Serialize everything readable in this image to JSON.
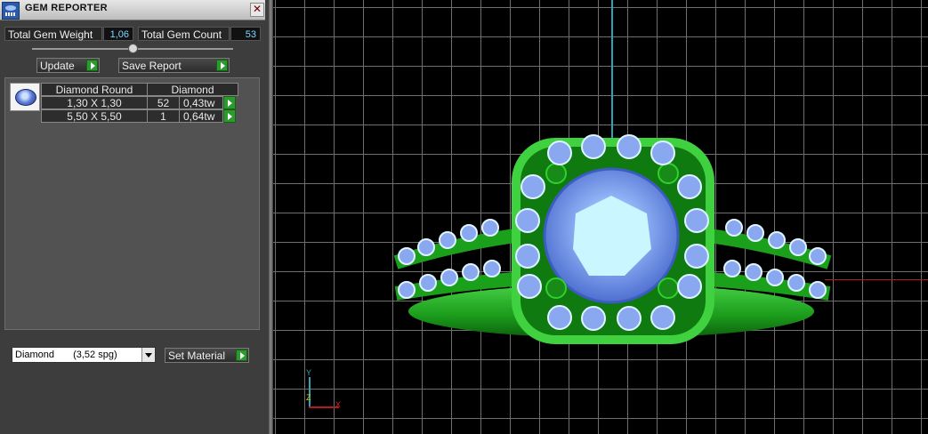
{
  "window": {
    "title": "GEM REPORTER",
    "close_icon": "close-icon"
  },
  "stats": {
    "weight_label": "Total Gem Weight",
    "weight_value": "1,06",
    "count_label": "Total Gem Count",
    "count_value": "53"
  },
  "buttons": {
    "update": "Update",
    "save_report": "Save Report",
    "set_material": "Set Material"
  },
  "table": {
    "headers": [
      "Diamond Round",
      "Diamond"
    ],
    "rows": [
      {
        "size": "1,30 X 1,30",
        "count": "52",
        "weight": "0,43tw"
      },
      {
        "size": "5,50 X 5,50",
        "count": "1",
        "weight": "0,64tw"
      }
    ]
  },
  "material": {
    "selected_name": "Diamond",
    "selected_spg": "(3,52 spg)"
  },
  "triad": {
    "z": "Z",
    "y": "Y",
    "x": "X"
  },
  "colors": {
    "panel": "#3d3d3d",
    "ring_metal": "#1fa81f",
    "gem": "#7f9ff0",
    "value_text": "#7ed7ff",
    "axis_y": "#2aa6b8",
    "axis_x": "#b11d1d"
  }
}
